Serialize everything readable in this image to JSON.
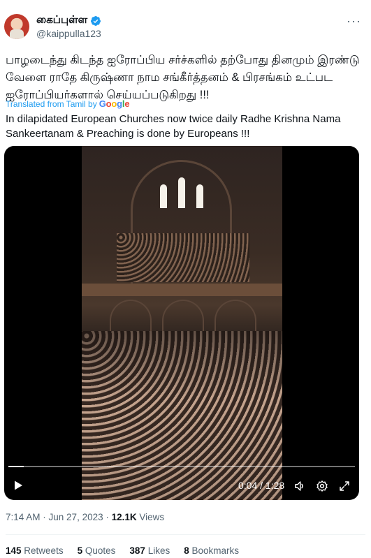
{
  "author": {
    "display_name": "கைப்புள்ள",
    "handle": "@kaippulla123",
    "verified_color": "#1d9bf0",
    "avatar_icon": "avatar"
  },
  "tweet": {
    "text_original": "பாழடைந்து கிடந்த ஐரோப்பிய சர்ச்களில் தற்போது தினமும் இரண்டு வேளை ராதே கிருஷ்ணா நாம சங்கீர்த்தனம் & பிரசங்கம் உட்பட ஐரோப்பியர்களால் செய்யப்படுகிறது !!!",
    "translated_label": "Translated from Tamil by",
    "translation_provider": {
      "g": "G",
      "o1": "o",
      "o2": "o",
      "g2": "g",
      "l": "l",
      "e": "e"
    },
    "text_translated": "In dilapidated European Churches now twice daily Radhe Krishna Nama Sankeertanam & Preaching is done by Europeans !!!"
  },
  "video": {
    "time_display": "0:04 / 1:28",
    "progress_fraction": 0.045,
    "controls": {
      "play": "play-icon",
      "volume": "volume-icon",
      "settings": "gear-icon",
      "fullscreen": "fullscreen-icon"
    }
  },
  "meta": {
    "time": "7:14 AM",
    "separator": " · ",
    "date": "Jun 27, 2023",
    "views_count": "12.1K",
    "views_label": "Views"
  },
  "stats": {
    "retweets_count": "145",
    "retweets_label": "Retweets",
    "quotes_count": "5",
    "quotes_label": "Quotes",
    "likes_count": "387",
    "likes_label": "Likes",
    "bookmarks_count": "8",
    "bookmarks_label": "Bookmarks"
  },
  "more_menu": "···",
  "colors": {
    "accent": "#1d9bf0",
    "text": "#0f1419",
    "muted": "#536471"
  }
}
